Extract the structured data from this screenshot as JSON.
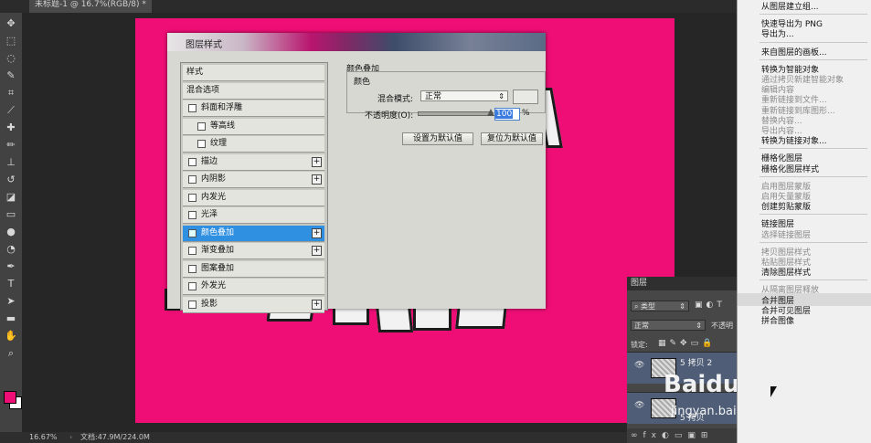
{
  "document_tab": {
    "title": "未标题-1 @ 16.7%(RGB/8) *"
  },
  "status_bar": {
    "zoom": "16.67%",
    "doc_size": "文档:47.9M/224.0M"
  },
  "toolbox": {
    "icons": [
      "move-icon",
      "marquee-icon",
      "lasso-icon",
      "quick-select-icon",
      "crop-icon",
      "eyedropper-icon",
      "healing-icon",
      "brush-icon",
      "clone-stamp-icon",
      "history-brush-icon",
      "eraser-icon",
      "gradient-icon",
      "blur-icon",
      "dodge-icon",
      "pen-icon",
      "type-icon",
      "path-select-icon",
      "rectangle-icon",
      "hand-icon",
      "zoom-icon"
    ],
    "foreground_color": "#ee0e76",
    "background_color": "#ffffff"
  },
  "dialog": {
    "title": "图层样式",
    "style_list": [
      {
        "label": "样式",
        "checkbox": false,
        "plus": false,
        "indent": 0
      },
      {
        "label": "混合选项",
        "checkbox": false,
        "plus": false,
        "indent": 0
      },
      {
        "label": "斜面和浮雕",
        "checkbox": true,
        "checked": false,
        "plus": false,
        "indent": 0
      },
      {
        "label": "等高线",
        "checkbox": true,
        "checked": false,
        "plus": false,
        "indent": 1
      },
      {
        "label": "纹理",
        "checkbox": true,
        "checked": false,
        "plus": false,
        "indent": 1
      },
      {
        "label": "描边",
        "checkbox": true,
        "checked": false,
        "plus": true,
        "indent": 0
      },
      {
        "label": "内阴影",
        "checkbox": true,
        "checked": false,
        "plus": true,
        "indent": 0
      },
      {
        "label": "内发光",
        "checkbox": true,
        "checked": false,
        "plus": false,
        "indent": 0
      },
      {
        "label": "光泽",
        "checkbox": true,
        "checked": false,
        "plus": false,
        "indent": 0
      },
      {
        "label": "颜色叠加",
        "checkbox": true,
        "checked": true,
        "plus": true,
        "indent": 0,
        "selected": true
      },
      {
        "label": "渐变叠加",
        "checkbox": true,
        "checked": false,
        "plus": true,
        "indent": 0
      },
      {
        "label": "图案叠加",
        "checkbox": true,
        "checked": false,
        "plus": false,
        "indent": 0
      },
      {
        "label": "外发光",
        "checkbox": true,
        "checked": false,
        "plus": false,
        "indent": 0
      },
      {
        "label": "投影",
        "checkbox": true,
        "checked": false,
        "plus": true,
        "indent": 0
      }
    ],
    "section_title": "颜色叠加",
    "group_title": "颜色",
    "blend_mode_label": "混合模式:",
    "blend_mode_value": "正常",
    "opacity_label": "不透明度(O):",
    "opacity_value": "100",
    "opacity_unit": "%",
    "opacity_fraction": 1.0,
    "set_default_button": "设置为默认值",
    "reset_default_button": "复位为默认值"
  },
  "layers_panel": {
    "title": "图层",
    "filter_label": "类型",
    "blend_mode": "正常",
    "opacity_label": "不透明",
    "lock_label": "锁定:",
    "layers": [
      {
        "name": "5 拷贝 2"
      },
      {
        "name": "5 拷贝"
      }
    ]
  },
  "context_menu": {
    "items": [
      {
        "label": "从图层建立组...",
        "enabled": true
      },
      {
        "sep": true
      },
      {
        "label": "快速导出为 PNG",
        "enabled": true
      },
      {
        "label": "导出为...",
        "enabled": true
      },
      {
        "sep": true
      },
      {
        "label": "来自图层的画板...",
        "enabled": true
      },
      {
        "sep": true
      },
      {
        "label": "转换为智能对象",
        "enabled": true
      },
      {
        "label": "通过拷贝新建智能对象",
        "enabled": false
      },
      {
        "label": "编辑内容",
        "enabled": false
      },
      {
        "label": "重新链接到文件...",
        "enabled": false
      },
      {
        "label": "重新链接到库图形...",
        "enabled": false
      },
      {
        "label": "替换内容...",
        "enabled": false
      },
      {
        "label": "导出内容...",
        "enabled": false
      },
      {
        "label": "转换为链接对象...",
        "enabled": true
      },
      {
        "sep": true
      },
      {
        "label": "栅格化图层",
        "enabled": true
      },
      {
        "label": "栅格化图层样式",
        "enabled": true
      },
      {
        "sep": true
      },
      {
        "label": "启用图层蒙版",
        "enabled": false
      },
      {
        "label": "启用矢量蒙版",
        "enabled": false
      },
      {
        "label": "创建剪贴蒙版",
        "enabled": true
      },
      {
        "sep": true
      },
      {
        "label": "链接图层",
        "enabled": true
      },
      {
        "label": "选择链接图层",
        "enabled": false
      },
      {
        "sep": true
      },
      {
        "label": "拷贝图层样式",
        "enabled": false
      },
      {
        "label": "粘贴图层样式",
        "enabled": false
      },
      {
        "label": "清除图层样式",
        "enabled": true
      },
      {
        "sep": true
      },
      {
        "label": "从隔离图层释放",
        "enabled": false
      },
      {
        "label": "合并图层",
        "enabled": true,
        "highlight": true
      },
      {
        "label": "合并可见图层",
        "enabled": true
      },
      {
        "label": "拼合图像",
        "enabled": true
      }
    ]
  },
  "watermark": {
    "brand": "Baidu经验",
    "site": "jingyan.baidu.com"
  }
}
